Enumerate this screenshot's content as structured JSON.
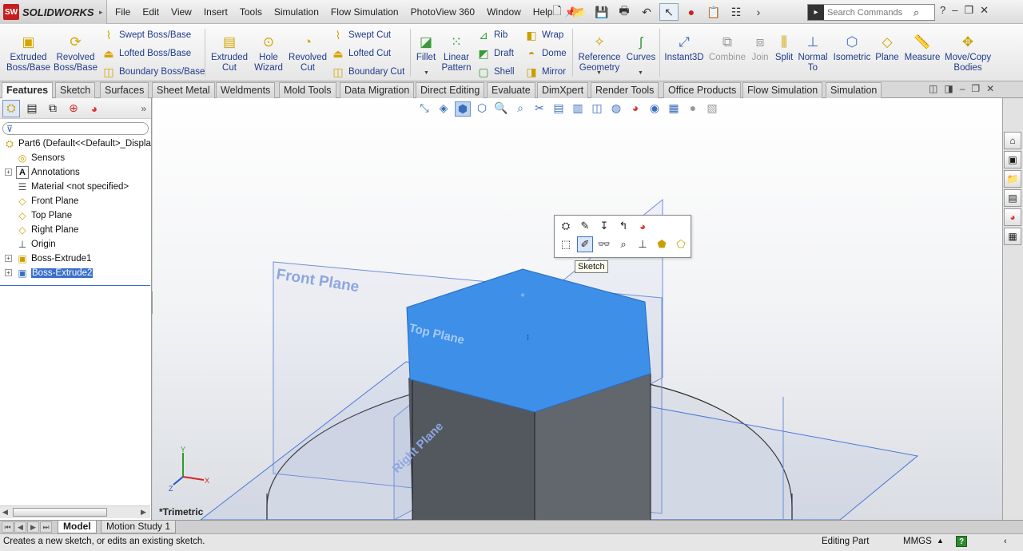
{
  "app": {
    "name": "SOLIDWORKS",
    "logo_badge": "SW"
  },
  "menu": [
    "File",
    "Edit",
    "View",
    "Insert",
    "Tools",
    "Simulation",
    "Flow Simulation",
    "PhotoView 360",
    "Window",
    "Help"
  ],
  "search": {
    "placeholder": "Search Commands"
  },
  "commands": {
    "extruded_boss": "Extruded\nBoss/Base",
    "revolved_boss": "Revolved\nBoss/Base",
    "swept_boss": "Swept Boss/Base",
    "lofted_boss": "Lofted Boss/Base",
    "boundary_boss": "Boundary Boss/Base",
    "extruded_cut": "Extruded\nCut",
    "hole_wizard": "Hole\nWizard",
    "revolved_cut": "Revolved\nCut",
    "swept_cut": "Swept Cut",
    "lofted_cut": "Lofted Cut",
    "boundary_cut": "Boundary Cut",
    "fillet": "Fillet",
    "linear_pattern": "Linear\nPattern",
    "rib": "Rib",
    "draft": "Draft",
    "shell": "Shell",
    "wrap": "Wrap",
    "dome": "Dome",
    "mirror": "Mirror",
    "reference_geometry": "Reference\nGeometry",
    "curves": "Curves",
    "instant3d": "Instant3D",
    "combine": "Combine",
    "join": "Join",
    "split": "Split",
    "normal_to": "Normal\nTo",
    "isometric": "Isometric",
    "plane": "Plane",
    "measure": "Measure",
    "move_copy": "Move/Copy\nBodies"
  },
  "tabs": [
    "Features",
    "Sketch",
    "Surfaces",
    "Sheet Metal",
    "Weldments",
    "Mold Tools",
    "Data Migration",
    "Direct Editing",
    "Evaluate",
    "DimXpert",
    "Render Tools",
    "Office Products",
    "Flow Simulation",
    "Simulation"
  ],
  "active_tab": "Features",
  "tree": {
    "root": "Part6  (Default<<Default>_Displa",
    "items": [
      "Sensors",
      "Annotations",
      "Material <not specified>",
      "Front Plane",
      "Top Plane",
      "Right Plane",
      "Origin",
      "Boss-Extrude1",
      "Boss-Extrude2"
    ],
    "selected": "Boss-Extrude2"
  },
  "viewport": {
    "view_name": "*Trimetric",
    "plane_labels": {
      "front": "Front Plane",
      "top": "Top Plane",
      "right": "Right Plane"
    },
    "tooltip": "Sketch",
    "triad": {
      "x": "X",
      "y": "Y",
      "z": "Z"
    },
    "colors": {
      "selected_face": "#3d8fe8",
      "body_side_dark": "#53585f",
      "body_side_mid": "#62666d",
      "plane_edge": "#4a78d9"
    }
  },
  "model_tabs": [
    "Model",
    "Motion Study 1"
  ],
  "status": {
    "message": "Creates a new sketch, or edits an existing sketch.",
    "editing": "Editing Part",
    "units": "MMGS",
    "help_icon": "?"
  }
}
